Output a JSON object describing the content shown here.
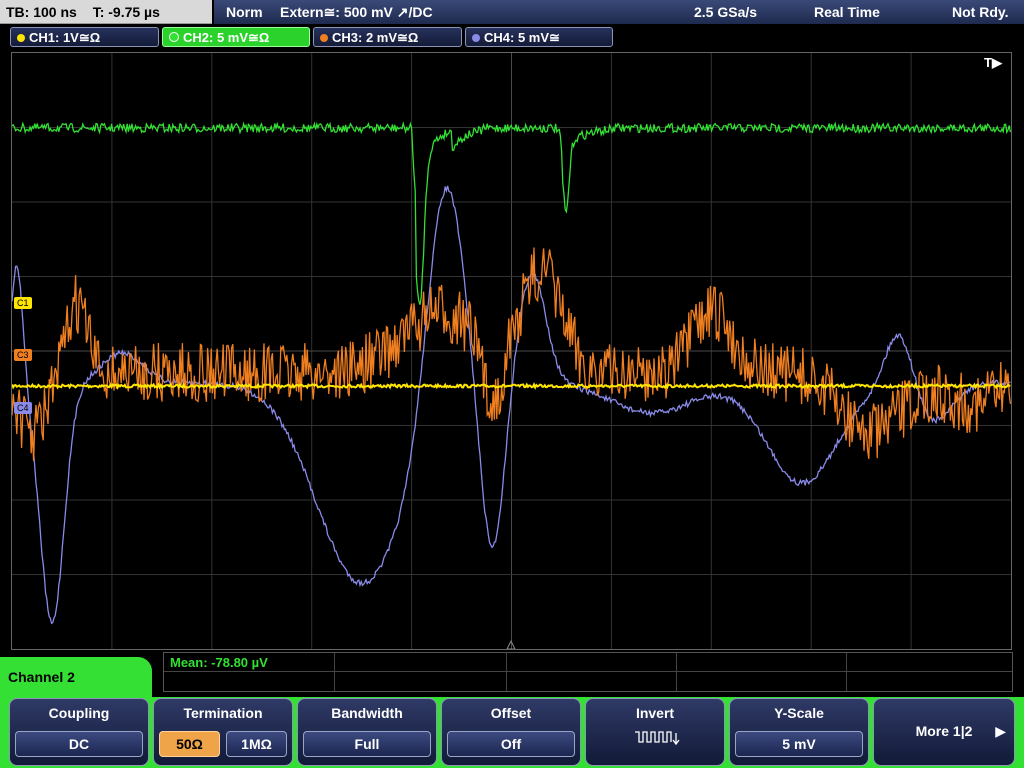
{
  "status": {
    "timebase": "TB: 100 ns",
    "trigger_time": "T: -9.75 µs",
    "mode": "Norm",
    "trigger": "Extern≅: 500 mV ↗/DC",
    "sample_rate": "2.5 GSa/s",
    "acquisition": "Real Time",
    "state": "Not Rdy."
  },
  "channels": [
    {
      "label": "CH1: 1V≅Ω",
      "color": "#ffe600"
    },
    {
      "label": "CH2: 5 mV≅Ω",
      "color": "#33e033"
    },
    {
      "label": "CH3: 2 mV≅Ω",
      "color": "#f07f20"
    },
    {
      "label": "CH4: 5 mV≅",
      "color": "#8a8ae8"
    }
  ],
  "trace_markers": {
    "c1": "C1",
    "c3": "C3",
    "c4": "C4",
    "trigger": "T▶"
  },
  "measurement": {
    "mean": "Mean: -78.80 µV"
  },
  "panel": {
    "title": "Channel 2"
  },
  "softkeys": {
    "coupling": {
      "label": "Coupling",
      "value": "DC"
    },
    "termination": {
      "label": "Termination",
      "option_50": "50Ω",
      "option_1m": "1MΩ"
    },
    "bandwidth": {
      "label": "Bandwidth",
      "value": "Full"
    },
    "offset": {
      "label": "Offset",
      "value": "Off"
    },
    "invert": {
      "label": "Invert",
      "icon": "inverted-square-wave-icon"
    },
    "yscale": {
      "label": "Y-Scale",
      "value": "5 mV"
    },
    "more": {
      "label": "More 1|2"
    }
  }
}
